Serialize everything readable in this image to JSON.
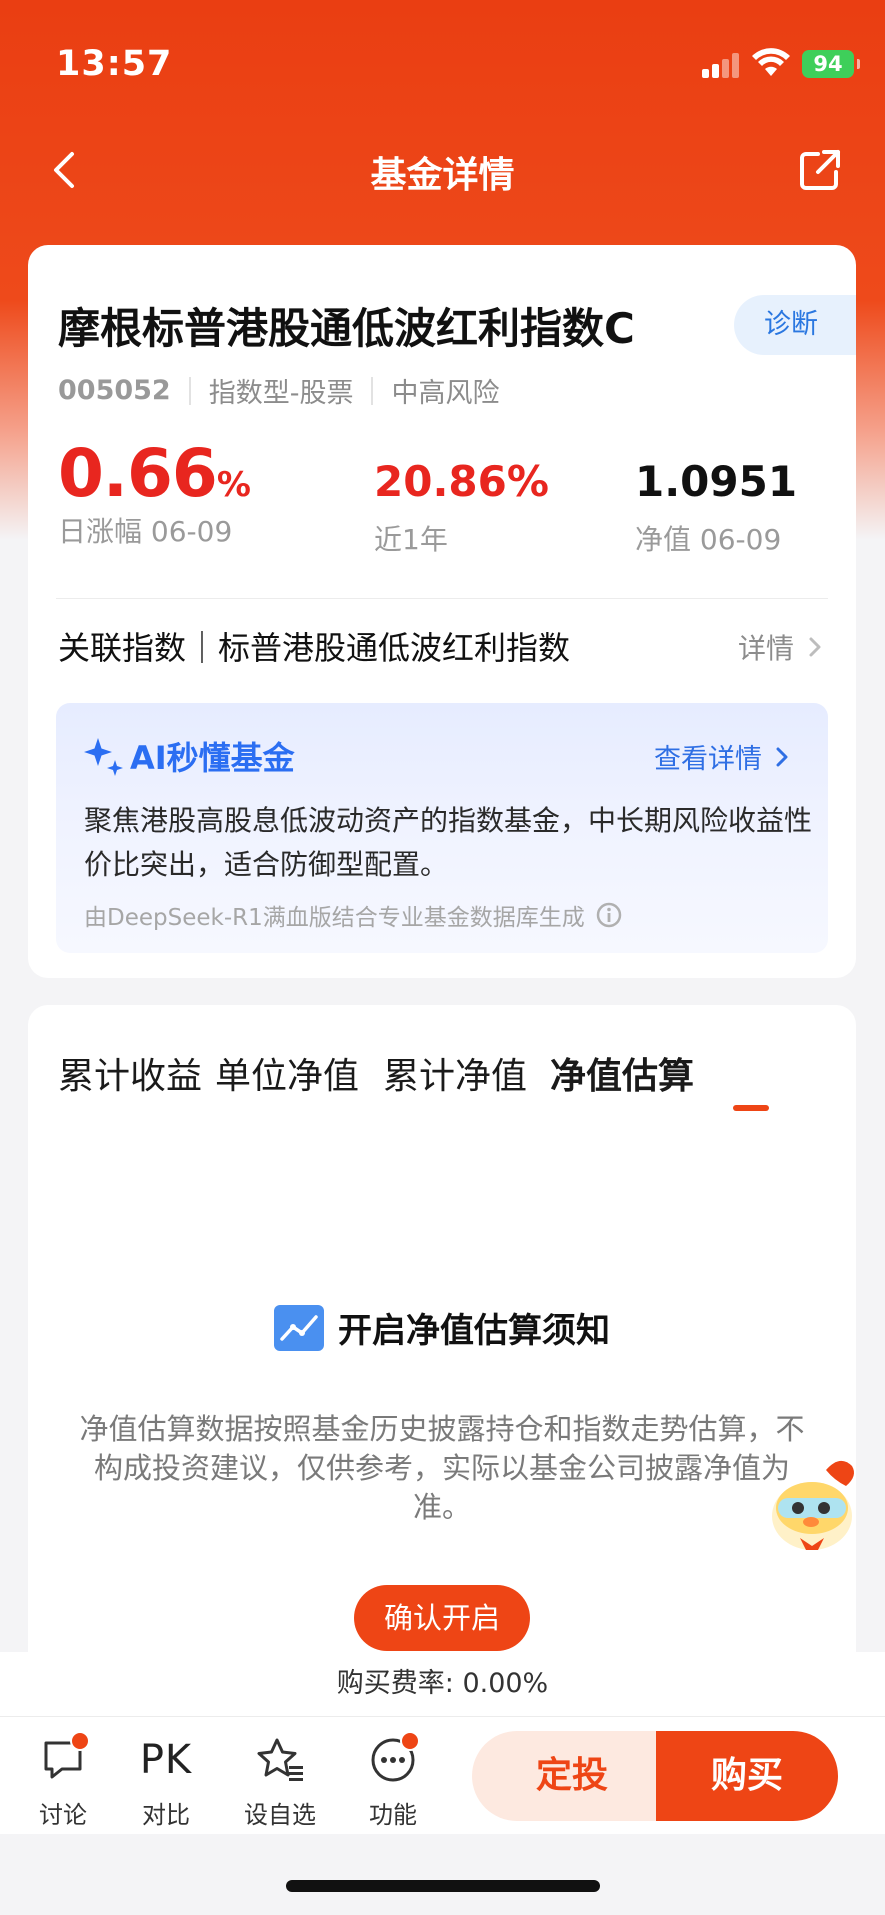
{
  "status_bar": {
    "time": "13:57",
    "battery": "94"
  },
  "nav": {
    "title": "基金详情"
  },
  "fund": {
    "name": "摩根标普港股通低波红利指数C",
    "diagnose_label": "诊断",
    "code": "005052",
    "type": "指数型-股票",
    "risk": "中高风险",
    "daily_change_value": "0.66",
    "daily_change_unit": "%",
    "daily_change_label": "日涨幅 06-09",
    "one_year_value": "20.86%",
    "one_year_label": "近1年",
    "nav_value": "1.0951",
    "nav_label": "净值 06-09",
    "index_row": "关联指数｜标普港股通低波红利指数",
    "index_detail": "详情"
  },
  "ai_box": {
    "title": "AI秒懂基金",
    "more": "查看详情",
    "text": "聚焦港股高股息低波动资产的指数基金，中长期风险收益性价比突出，适合防御型配置。",
    "note": "由DeepSeek-R1满血版结合专业基金数据库生成"
  },
  "tabs": [
    {
      "label": "累计收益"
    },
    {
      "label": "单位净值"
    },
    {
      "label": "累计净值"
    },
    {
      "label": "净值估算",
      "active": true
    }
  ],
  "notice": {
    "title": "开启净值估算须知",
    "text": "净值估算数据按照基金历史披露持仓和指数走势估算，不构成投资建议，仅供参考，实际以基金公司披露净值为准。",
    "confirm": "确认开启"
  },
  "fee": "购买费率: 0.00%",
  "bottom_bar": {
    "discuss": "讨论",
    "compare_icon_text": "PK",
    "compare": "对比",
    "watch": "设自选",
    "functions": "功能",
    "dingtou": "定投",
    "buy": "购买"
  },
  "colors": {
    "brand": "#ee4515",
    "up": "#e8261f",
    "ai_blue": "#2b6ef2"
  }
}
